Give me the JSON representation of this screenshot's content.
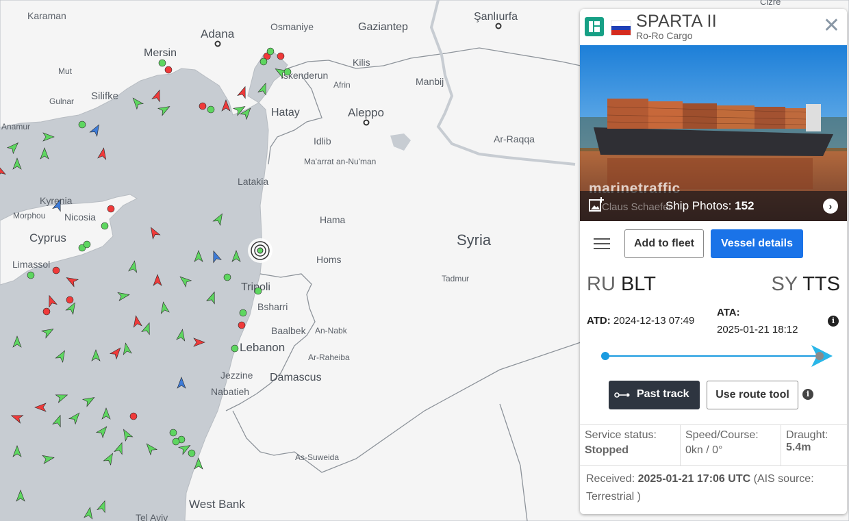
{
  "map": {
    "labels": {
      "karaman": "Karaman",
      "adana": "Adana",
      "osmaniye": "Osmaniye",
      "gaziantep": "Gaziantep",
      "sanliurfa": "Şanlıurfa",
      "mersin": "Mersin",
      "mut": "Mut",
      "silifke": "Silifke",
      "gulnar": "Gulnar",
      "anamur": "Anamur",
      "iskenderun": "İskenderun",
      "kilis": "Kilis",
      "afrin": "Afrin",
      "manbij": "Manbij",
      "hatay": "Hatay",
      "aleppo": "Aleppo",
      "idlib": "Idlib",
      "ar_raqqa": "Ar-Raqqa",
      "maarat": "Ma'arrat an-Nu'man",
      "latakia": "Latakia",
      "kyrenia": "Kyrenia",
      "morphou": "Morphou",
      "nicosia": "Nicosia",
      "cyprus": "Cyprus",
      "limassol": "Limassol",
      "hama": "Hama",
      "syria": "Syria",
      "homs": "Homs",
      "tadmur": "Tadmur",
      "tripoli": "Tripoli",
      "bsharri": "Bsharri",
      "baalbek": "Baalbek",
      "an_nabk": "An-Nabk",
      "lebanon": "Lebanon",
      "ar_raheiba": "Ar-Raheiba",
      "jezzine": "Jezzine",
      "damascus": "Damascus",
      "nabatieh": "Nabatieh",
      "as_suweida": "As-Suweida",
      "west_bank": "West Bank",
      "tel_aviv": "Tel Aviv",
      "cizre": "Cizre"
    },
    "colors": {
      "sea": "#c7ccd2",
      "land": "#f5f5f5",
      "cargo": "#5ed660",
      "tanker": "#ef3a3a",
      "passenger": "#3d7bd8",
      "selected": "#ffffff"
    }
  },
  "panel": {
    "vessel_name": "SPARTA II",
    "vessel_type": "Ro-Ro Cargo",
    "flag_icon": "russia-flag-icon",
    "photo": {
      "watermark": "marinetraffic",
      "credit": "Claus Schaefer",
      "photos_label": "Ship Photos:",
      "photos_count": "152"
    },
    "actions": {
      "add_to_fleet": "Add to fleet",
      "vessel_details": "Vessel details"
    },
    "route": {
      "from_country": "RU",
      "from_port": "BLT",
      "to_country": "SY",
      "to_port": "TTS",
      "atd_label": "ATD:",
      "atd_value": "2024-12-13 07:49",
      "ata_label": "ATA:",
      "ata_value": "2025-01-21 18:12"
    },
    "tools": {
      "past_track": "Past track",
      "route_tool": "Use route tool"
    },
    "status": {
      "service_label": "Service status:",
      "service_value": "Stopped",
      "speed_label": "Speed/Course:",
      "speed_value": "0kn / 0°",
      "draught_label": "Draught:",
      "draught_value": "5.4m"
    },
    "received": {
      "prefix": "Received:",
      "time": "2025-01-21 17:06 UTC",
      "suffix": "(AIS source: Terrestrial )"
    },
    "accent_color": "#1a73e8"
  }
}
